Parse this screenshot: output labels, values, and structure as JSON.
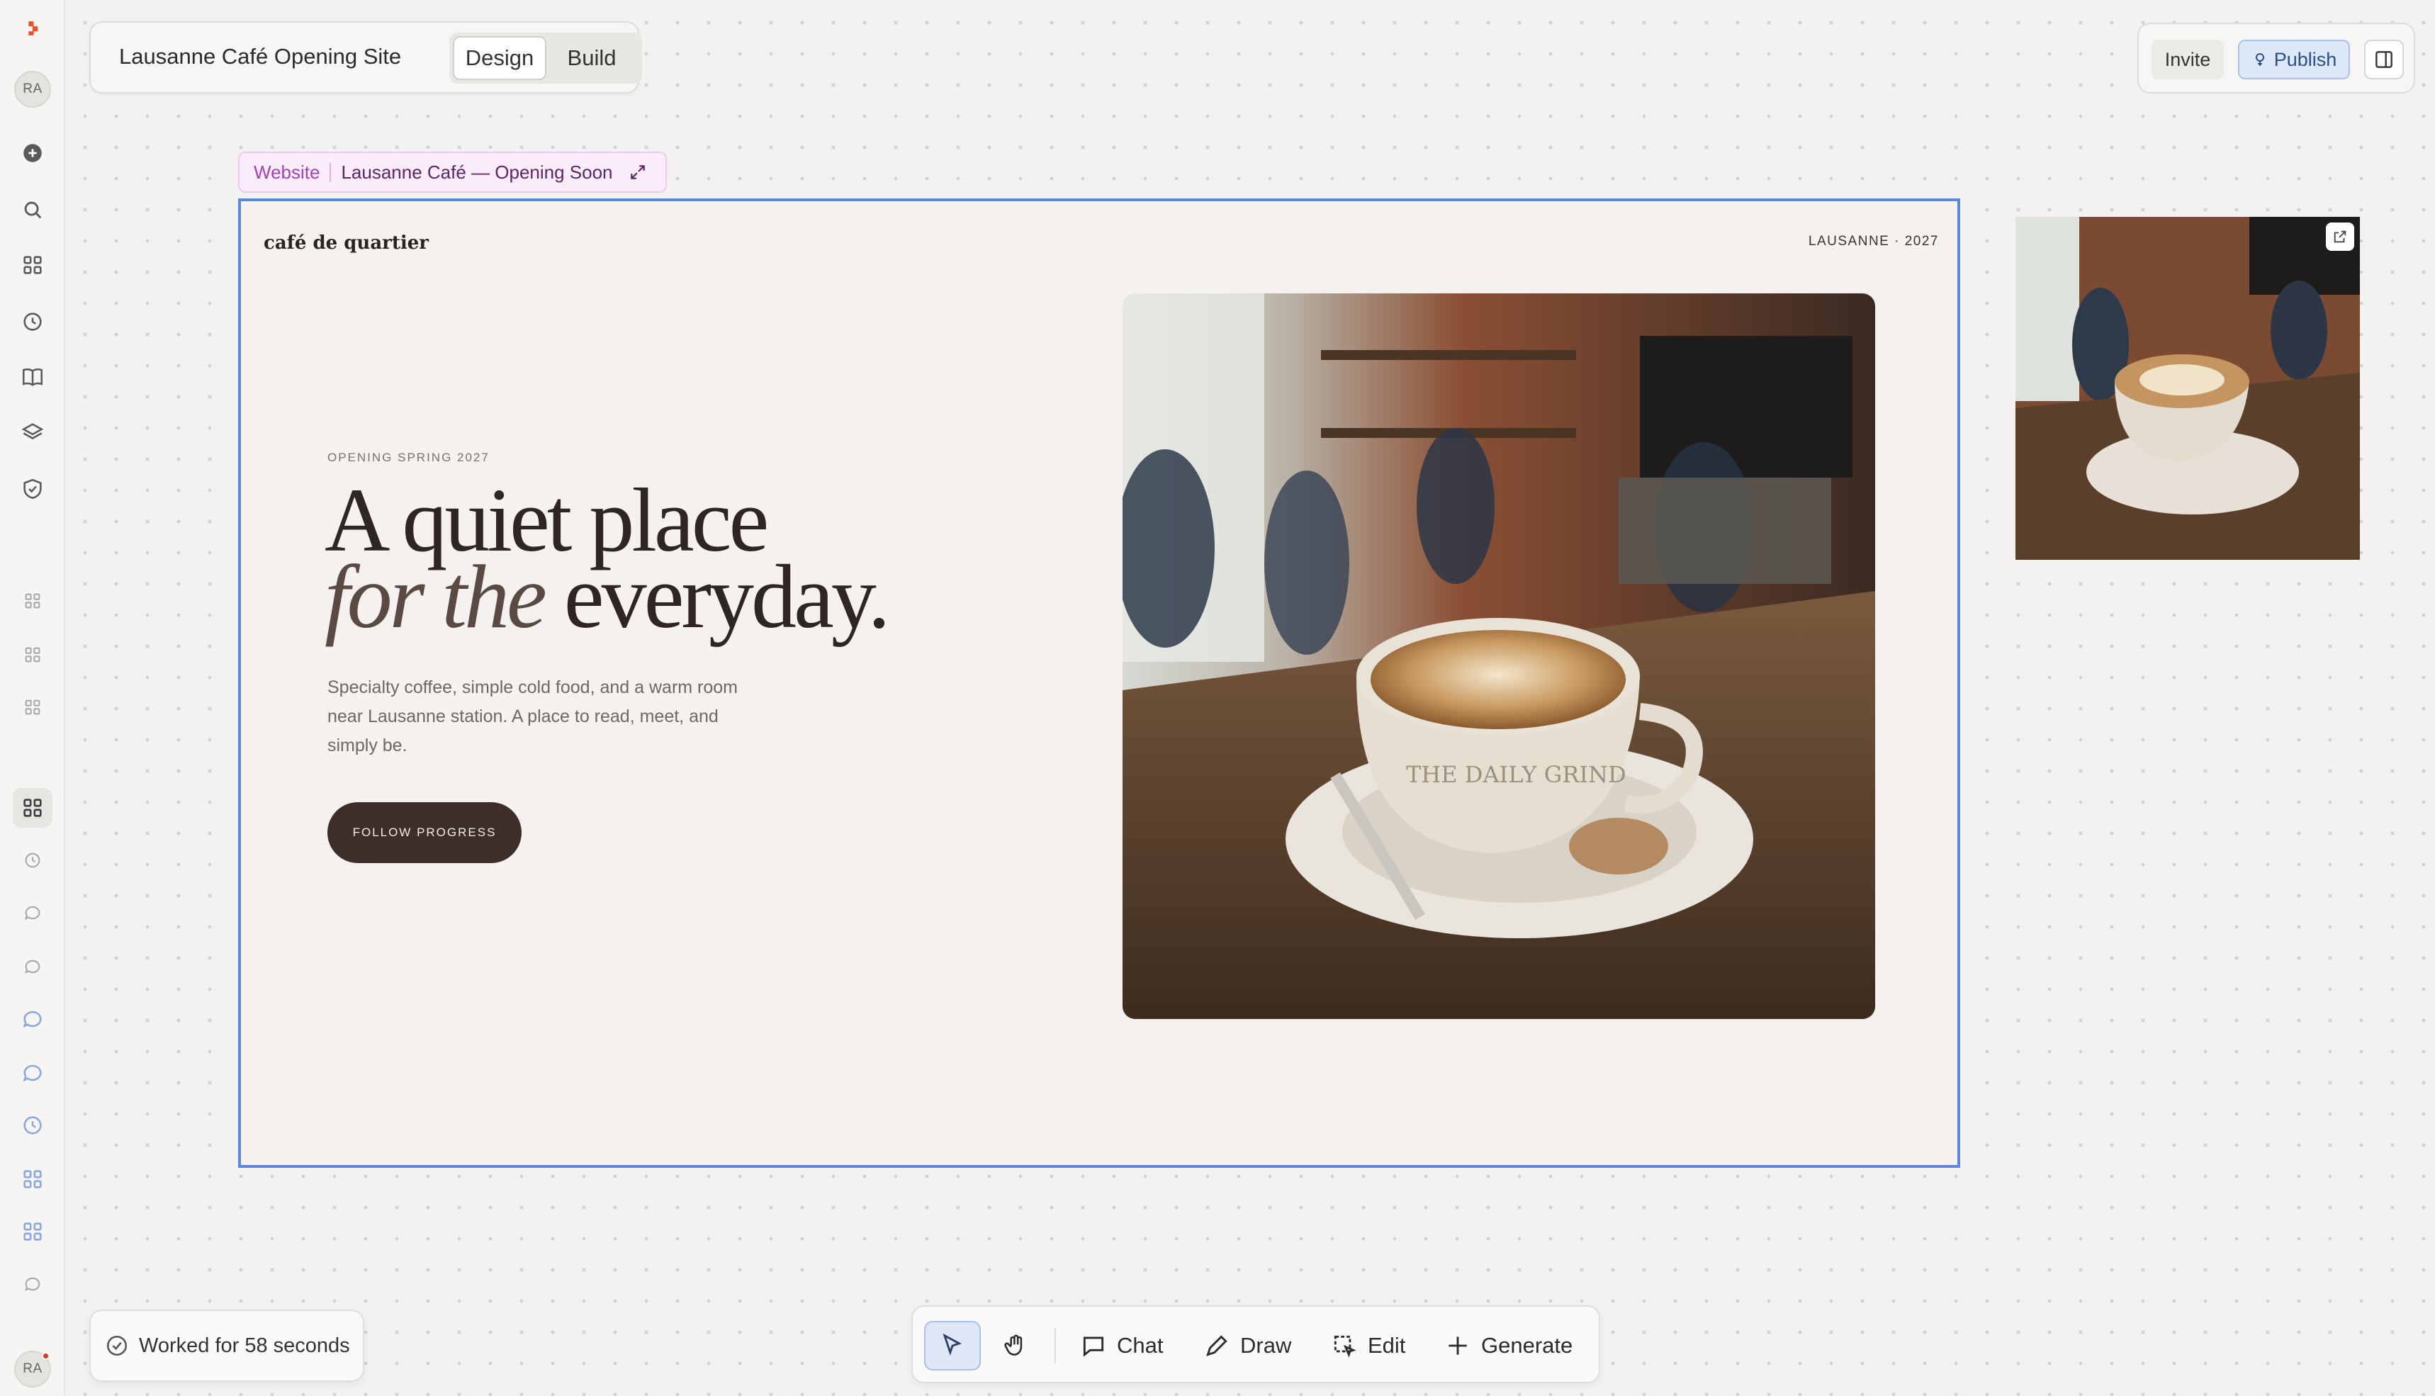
{
  "sidebar": {
    "avatar_initials": "RA",
    "bottom_avatar_initials": "RA"
  },
  "project": {
    "title": "Lausanne Café Opening Site",
    "mode_design": "Design",
    "mode_build": "Build"
  },
  "top_right": {
    "invite_label": "Invite",
    "publish_label": "Publish"
  },
  "frame": {
    "kind": "Website",
    "name": "Lausanne Café — Opening Soon"
  },
  "site": {
    "brand": "café de quartier",
    "location": "LAUSANNE · 2027",
    "eyebrow": "OPENING SPRING 2027",
    "headline_line1": "A quiet place",
    "headline_italic": "for the",
    "headline_end": "everyday.",
    "body": "Specialty coffee, simple cold food, and a warm room near Lausanne station. A place to read, meet, and simply be.",
    "cta": "FOLLOW PROGRESS",
    "photo_cup_text": "THE DAILY GRIND"
  },
  "status": {
    "text": "Worked for 58 seconds"
  },
  "toolbar": {
    "chat": "Chat",
    "draw": "Draw",
    "edit": "Edit",
    "generate": "Generate"
  },
  "colors": {
    "selection_blue": "#5b86dc",
    "frame_label_pink": "#a342b3",
    "cta_brown": "#3d2e29",
    "publish_bg": "#dce8f8"
  }
}
